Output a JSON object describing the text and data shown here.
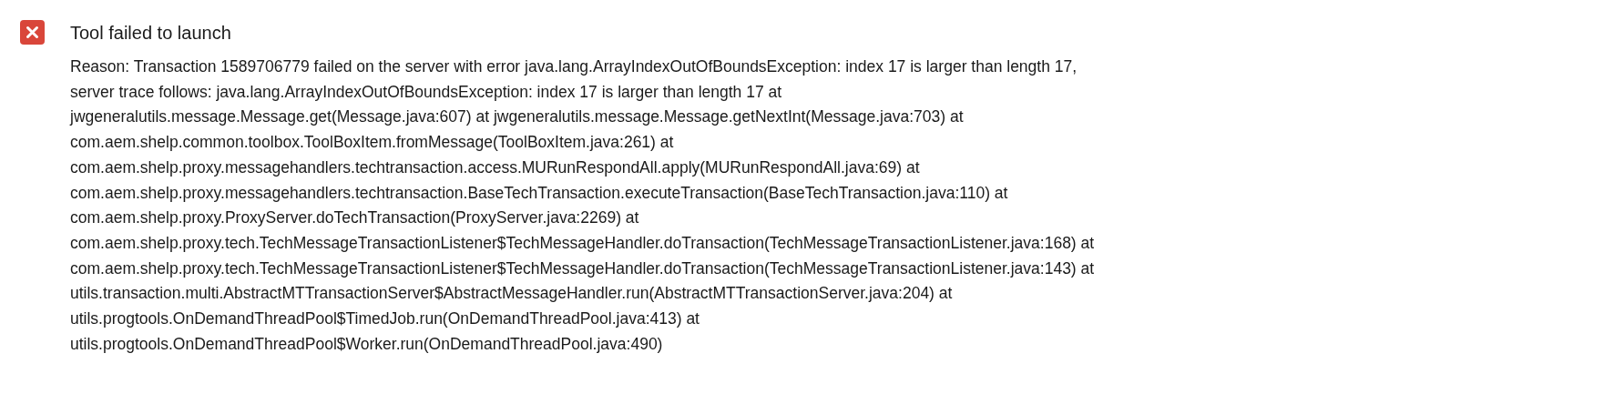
{
  "dialog": {
    "title": "Tool failed to launch",
    "message_lines": [
      "Reason: Transaction 1589706779 failed on the server with error java.lang.ArrayIndexOutOfBoundsException: index 17 is larger than length 17,",
      "server trace follows: java.lang.ArrayIndexOutOfBoundsException: index 17 is larger than length 17 at",
      "jwgeneralutils.message.Message.get(Message.java:607) at jwgeneralutils.message.Message.getNextInt(Message.java:703) at",
      "com.aem.shelp.common.toolbox.ToolBoxItem.fromMessage(ToolBoxItem.java:261) at",
      "com.aem.shelp.proxy.messagehandlers.techtransaction.access.MURunRespondAll.apply(MURunRespondAll.java:69) at",
      "com.aem.shelp.proxy.messagehandlers.techtransaction.BaseTechTransaction.executeTransaction(BaseTechTransaction.java:110) at",
      "com.aem.shelp.proxy.ProxyServer.doTechTransaction(ProxyServer.java:2269) at",
      "com.aem.shelp.proxy.tech.TechMessageTransactionListener$TechMessageHandler.doTransaction(TechMessageTransactionListener.java:168) at",
      "com.aem.shelp.proxy.tech.TechMessageTransactionListener$TechMessageHandler.doTransaction(TechMessageTransactionListener.java:143) at",
      "utils.transaction.multi.AbstractMTTransactionServer$AbstractMessageHandler.run(AbstractMTTransactionServer.java:204) at",
      "utils.progtools.OnDemandThreadPool$TimedJob.run(OnDemandThreadPool.java:413) at",
      "utils.progtools.OnDemandThreadPool$Worker.run(OnDemandThreadPool.java:490)"
    ]
  }
}
